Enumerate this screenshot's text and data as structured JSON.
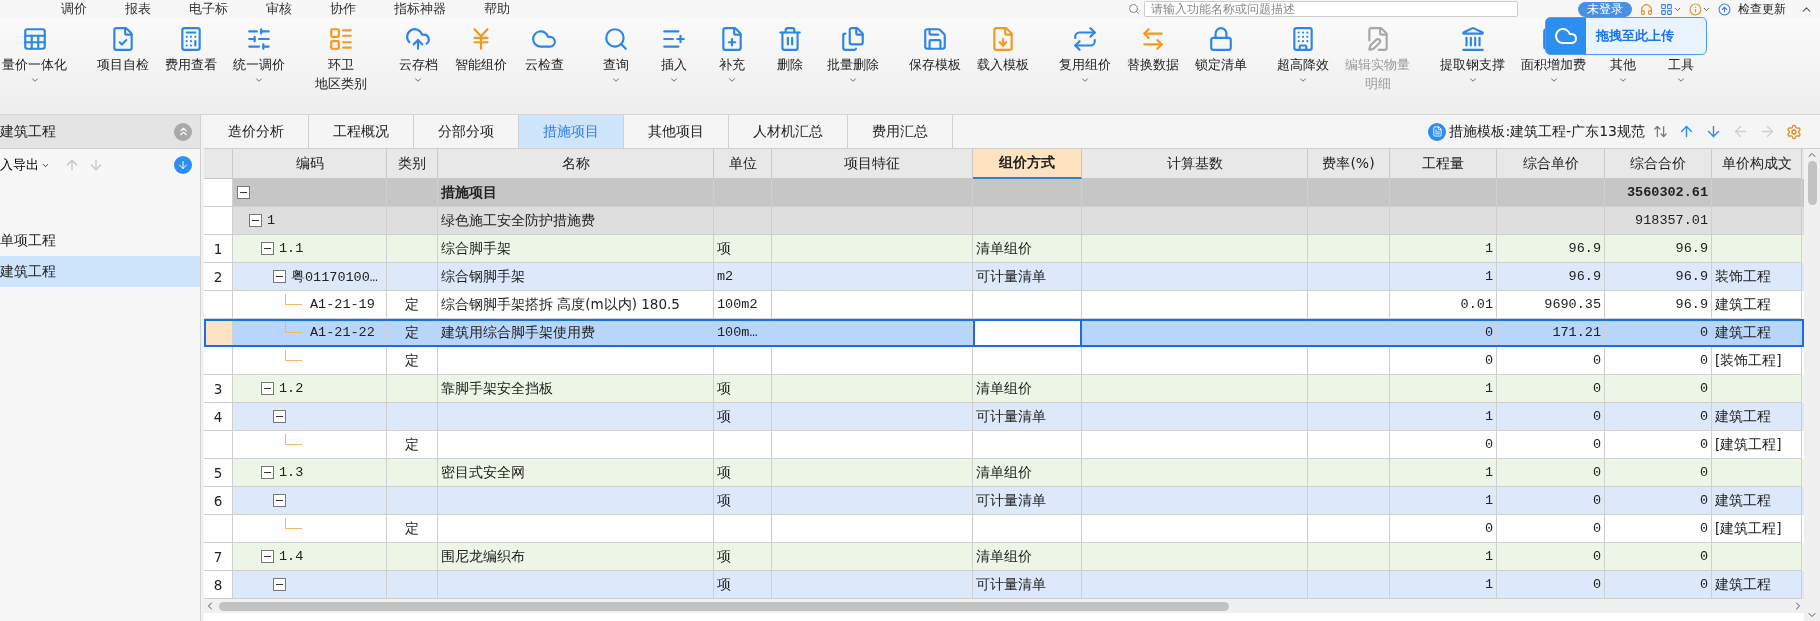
{
  "menu": [
    {
      "label": "调价",
      "selected": false
    },
    {
      "label": "报表",
      "selected": false
    },
    {
      "label": "电子标",
      "selected": false
    },
    {
      "label": "审核",
      "selected": false
    },
    {
      "label": "协作",
      "selected": false
    },
    {
      "label": "指标神器",
      "selected": false
    },
    {
      "label": "帮助",
      "selected": false
    }
  ],
  "search": {
    "placeholder": "请输入功能名称或问题描述"
  },
  "account": {
    "login": "未登录",
    "update": "检查更新"
  },
  "upload_popup": {
    "label": "拖拽至此上传"
  },
  "toolbar": [
    [
      {
        "lines": [
          "量价一体化"
        ],
        "dropdown": true,
        "disabled": false
      }
    ],
    [
      {
        "lines": [
          "项目自检"
        ],
        "dropdown": false,
        "disabled": false
      },
      {
        "lines": [
          "费用查看"
        ],
        "dropdown": false,
        "disabled": false
      },
      {
        "lines": [
          "统一调价"
        ],
        "dropdown": true,
        "disabled": false
      }
    ],
    [
      {
        "lines": [
          "环卫",
          "地区类别"
        ],
        "dropdown": false,
        "disabled": false
      }
    ],
    [
      {
        "lines": [
          "云存档"
        ],
        "dropdown": true,
        "disabled": false
      },
      {
        "lines": [
          "智能组价"
        ],
        "dropdown": false,
        "disabled": false
      },
      {
        "lines": [
          "云检查"
        ],
        "dropdown": false,
        "disabled": false
      }
    ],
    [
      {
        "lines": [
          "查询"
        ],
        "dropdown": true,
        "disabled": false
      },
      {
        "lines": [
          "插入"
        ],
        "dropdown": true,
        "disabled": false
      },
      {
        "lines": [
          "补充"
        ],
        "dropdown": true,
        "disabled": false
      },
      {
        "lines": [
          "删除"
        ],
        "dropdown": false,
        "disabled": false
      },
      {
        "lines": [
          "批量删除"
        ],
        "dropdown": true,
        "disabled": false
      }
    ],
    [
      {
        "lines": [
          "保存模板"
        ],
        "dropdown": false,
        "disabled": false
      },
      {
        "lines": [
          "载入模板"
        ],
        "dropdown": false,
        "disabled": false
      }
    ],
    [
      {
        "lines": [
          "复用组价"
        ],
        "dropdown": true,
        "disabled": false
      },
      {
        "lines": [
          "替换数据"
        ],
        "dropdown": false,
        "disabled": false
      },
      {
        "lines": [
          "锁定清单"
        ],
        "dropdown": false,
        "disabled": false
      }
    ],
    [
      {
        "lines": [
          "超高降效"
        ],
        "dropdown": true,
        "disabled": false
      },
      {
        "lines": [
          "编辑实物量",
          "明细"
        ],
        "dropdown": false,
        "disabled": true
      }
    ],
    [
      {
        "lines": [
          "提取钢支撑"
        ],
        "dropdown": true,
        "disabled": false
      },
      {
        "lines": [
          "面积增加费"
        ],
        "dropdown": true,
        "disabled": false
      },
      {
        "lines": [
          "其他"
        ],
        "dropdown": true,
        "disabled": false
      },
      {
        "lines": [
          "工具"
        ],
        "dropdown": true,
        "disabled": false
      }
    ]
  ],
  "sidebar": {
    "title": "建筑工程",
    "import_export": "入导出",
    "items": [
      {
        "label": "单项工程",
        "selected": false
      },
      {
        "label": "建筑工程",
        "selected": true
      }
    ]
  },
  "tabs": [
    {
      "label": "造价分析",
      "selected": false
    },
    {
      "label": "工程概况",
      "selected": false
    },
    {
      "label": "分部分项",
      "selected": false
    },
    {
      "label": "措施项目",
      "selected": true
    },
    {
      "label": "其他项目",
      "selected": false
    },
    {
      "label": "人材机汇总",
      "selected": false
    },
    {
      "label": "费用汇总",
      "selected": false
    }
  ],
  "template": {
    "label": "措施模板:建筑工程-广东13规范"
  },
  "table": {
    "columns": [
      {
        "selected": false
      },
      {
        "label": "编码",
        "selected": false
      },
      {
        "label": "类别",
        "selected": false
      },
      {
        "label": "名称",
        "selected": false
      },
      {
        "label": "单位",
        "selected": false
      },
      {
        "label": "项目特征",
        "selected": false
      },
      {
        "label": "组价方式",
        "selected": true
      },
      {
        "label": "计算基数",
        "selected": false
      },
      {
        "label": "费率(%)",
        "selected": false
      },
      {
        "label": "工程量",
        "selected": false
      },
      {
        "label": "综合单价",
        "selected": false
      },
      {
        "label": "综合合价",
        "selected": false
      },
      {
        "label": "单价构成文",
        "selected": false
      }
    ],
    "rows": [
      {
        "kind": "section",
        "expanded": true,
        "selected": false,
        "name": "措施项目",
        "total": "3560302.61",
        "children": [
          {
            "kind": "group",
            "expanded": true,
            "selected": false,
            "code": "1",
            "name": "绿色施工安全防护措施费",
            "total": "918357.01",
            "children": [
              {
                "kind": "bill",
                "expanded": true,
                "selected": false,
                "no": "1",
                "code": "1.1",
                "name": "综合脚手架",
                "unit": "项",
                "method": "清单组价",
                "qty": "1",
                "price": "96.9",
                "total": "96.9",
                "children": [
                  {
                    "kind": "list",
                    "expanded": true,
                    "selected": false,
                    "no": "2",
                    "code": "粤01170100…",
                    "name": "综合钢脚手架",
                    "unit": "m2",
                    "method": "可计量清单",
                    "qty": "1",
                    "price": "96.9",
                    "total": "96.9",
                    "file": "装饰工程",
                    "children": [
                      {
                        "kind": "quota",
                        "selected": false,
                        "code": "A1-21-19",
                        "type": "定",
                        "name": "综合钢脚手架搭拆 高度(m以内) 180.5",
                        "unit": "100m2",
                        "qty": "0.01",
                        "price": "9690.35",
                        "total": "96.9",
                        "file": "建筑工程"
                      },
                      {
                        "kind": "quota",
                        "selected": true,
                        "code": "A1-21-22",
                        "type": "定",
                        "name": "建筑用综合脚手架使用费",
                        "unit": "100m…",
                        "qty": "0",
                        "price": "171.21",
                        "total": "0",
                        "file": "建筑工程"
                      },
                      {
                        "kind": "quota",
                        "selected": false,
                        "type": "定",
                        "qty": "0",
                        "price": "0",
                        "total": "0",
                        "file": "[装饰工程]"
                      }
                    ]
                  }
                ]
              },
              {
                "kind": "bill",
                "expanded": true,
                "selected": false,
                "no": "3",
                "code": "1.2",
                "name": "靠脚手架安全挡板",
                "unit": "项",
                "method": "清单组价",
                "qty": "1",
                "price": "0",
                "total": "0",
                "children": [
                  {
                    "kind": "list",
                    "expanded": true,
                    "selected": false,
                    "no": "4",
                    "unit": "项",
                    "method": "可计量清单",
                    "qty": "1",
                    "price": "0",
                    "total": "0",
                    "file": "建筑工程",
                    "children": [
                      {
                        "kind": "quota",
                        "selected": false,
                        "type": "定",
                        "qty": "0",
                        "price": "0",
                        "total": "0",
                        "file": "[建筑工程]"
                      }
                    ]
                  }
                ]
              },
              {
                "kind": "bill",
                "expanded": true,
                "selected": false,
                "no": "5",
                "code": "1.3",
                "name": "密目式安全网",
                "unit": "项",
                "method": "清单组价",
                "qty": "1",
                "price": "0",
                "total": "0",
                "children": [
                  {
                    "kind": "list",
                    "expanded": true,
                    "selected": false,
                    "no": "6",
                    "unit": "项",
                    "method": "可计量清单",
                    "qty": "1",
                    "price": "0",
                    "total": "0",
                    "file": "建筑工程",
                    "children": [
                      {
                        "kind": "quota",
                        "selected": false,
                        "type": "定",
                        "qty": "0",
                        "price": "0",
                        "total": "0",
                        "file": "[建筑工程]"
                      }
                    ]
                  }
                ]
              },
              {
                "kind": "bill",
                "expanded": true,
                "selected": false,
                "no": "7",
                "code": "1.4",
                "name": "围尼龙编织布",
                "unit": "项",
                "method": "清单组价",
                "qty": "1",
                "price": "0",
                "total": "0",
                "children": [
                  {
                    "kind": "list",
                    "expanded": true,
                    "selected": false,
                    "no": "8",
                    "unit": "项",
                    "method": "可计量清单",
                    "qty": "1",
                    "price": "0",
                    "total": "0",
                    "file": "建筑工程"
                  }
                ]
              }
            ]
          }
        ]
      }
    ]
  }
}
